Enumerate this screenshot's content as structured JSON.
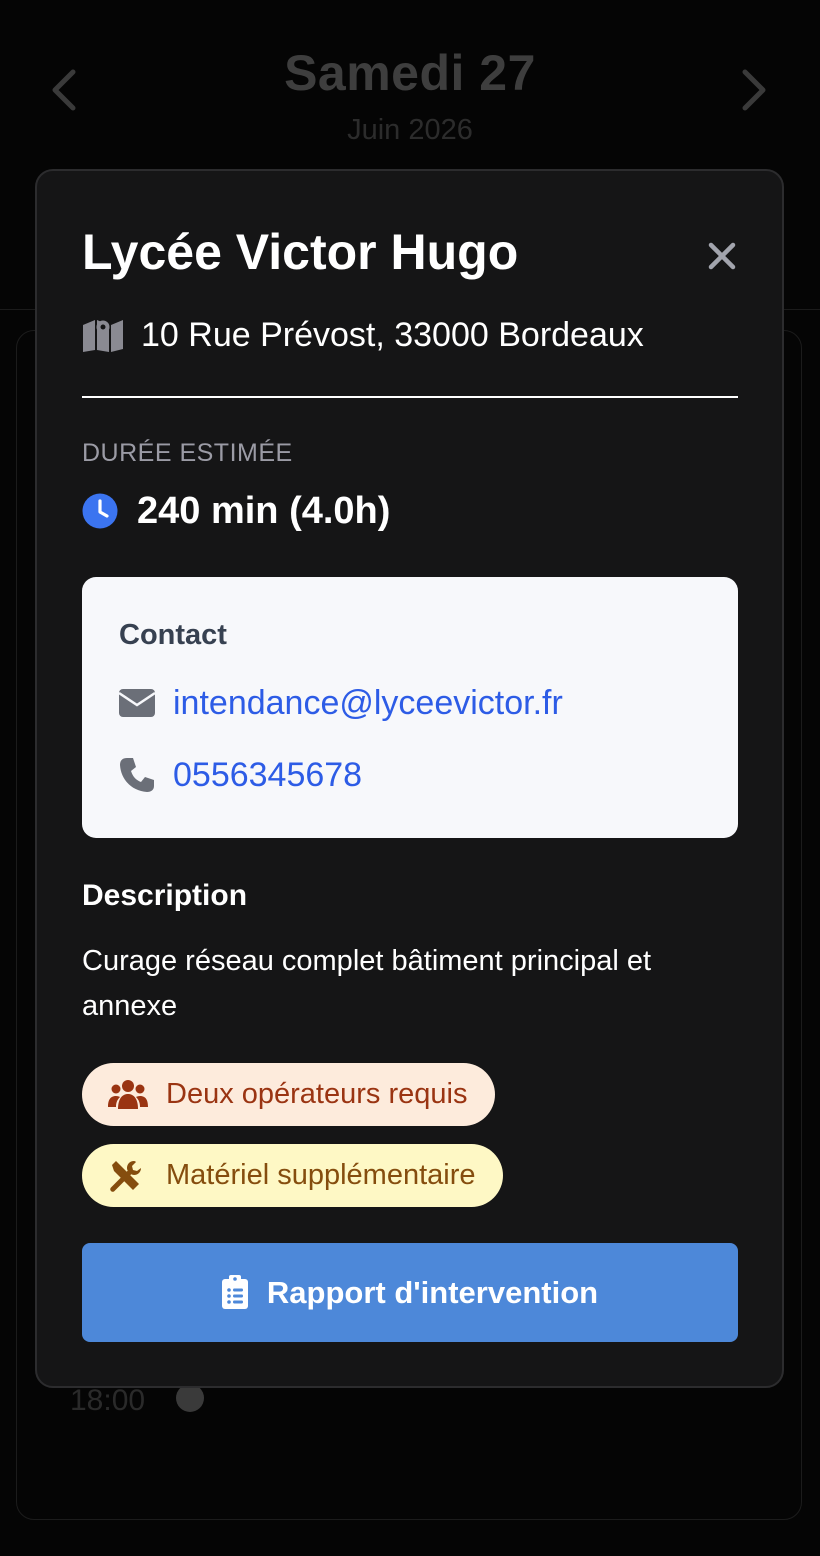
{
  "header": {
    "title": "Samedi 27",
    "subtitle": "Juin 2026"
  },
  "timeline": {
    "visible_time": "18:00"
  },
  "modal": {
    "title": "Lycée Victor Hugo",
    "address": "10 Rue Prévost, 33000 Bordeaux",
    "duration_label": "DURÉE ESTIMÉE",
    "duration_value": "240 min (4.0h)",
    "contact": {
      "title": "Contact",
      "email": "intendance@lyceevictor.fr",
      "phone": "0556345678"
    },
    "description_title": "Description",
    "description_text": "Curage réseau complet bâtiment principal et annexe",
    "badges": [
      {
        "label": "Deux opérateurs requis",
        "icon": "users-icon",
        "text_color": "#9a3412",
        "bg_color": "#fdebdc"
      },
      {
        "label": "Matériel supplémentaire",
        "icon": "tools-icon",
        "text_color": "#854d0e",
        "bg_color": "#fef8c5"
      }
    ],
    "report_button_label": "Rapport d'intervention"
  },
  "colors": {
    "accent_button": "#4d88d9",
    "link": "#2d5ce6",
    "clock_icon": "#3b74f0",
    "modal_bg": "#151516"
  }
}
